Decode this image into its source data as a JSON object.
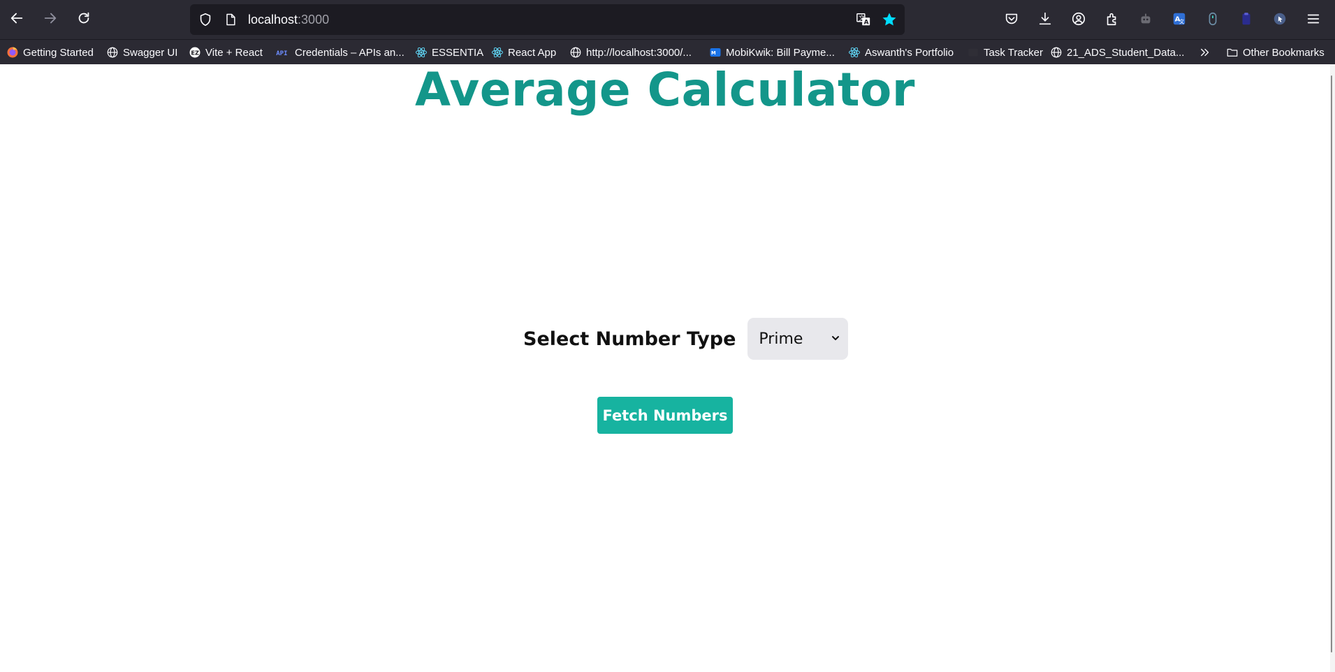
{
  "browser": {
    "url_host": "localhost",
    "url_port": ":3000",
    "bookmarks": [
      {
        "label": "Getting Started",
        "icon": "firefox-icon"
      },
      {
        "label": "Swagger UI",
        "icon": "globe-icon"
      },
      {
        "label": "Vite + React",
        "icon": "ez-icon"
      },
      {
        "label": "Credentials – APIs an...",
        "icon": "api-icon"
      },
      {
        "label": "ESSENTIA",
        "icon": "react-icon"
      },
      {
        "label": "React App",
        "icon": "react-icon"
      },
      {
        "label": "http://localhost:3000/...",
        "icon": "globe-icon"
      },
      {
        "label": "MobiKwik: Bill Payme...",
        "icon": "mobikwik-icon"
      },
      {
        "label": "Aswanth's Portfolio",
        "icon": "react-icon"
      },
      {
        "label": "Task Tracker",
        "icon": "blank-icon"
      },
      {
        "label": "21_ADS_Student_Data...",
        "icon": "globe-icon"
      }
    ],
    "other_bookmarks": "Other Bookmarks",
    "colors": {
      "chrome_bg": "#2b2a33",
      "urlbar_bg": "#1c1b22",
      "star_active": "#00ddff"
    }
  },
  "app": {
    "title": "Average Calculator",
    "select_label": "Select Number Type",
    "select_value": "Prime",
    "fetch_button": "Fetch Numbers",
    "colors": {
      "title": "#13968a",
      "button_bg": "#17b3a0",
      "select_bg": "#e8e8ec"
    }
  }
}
